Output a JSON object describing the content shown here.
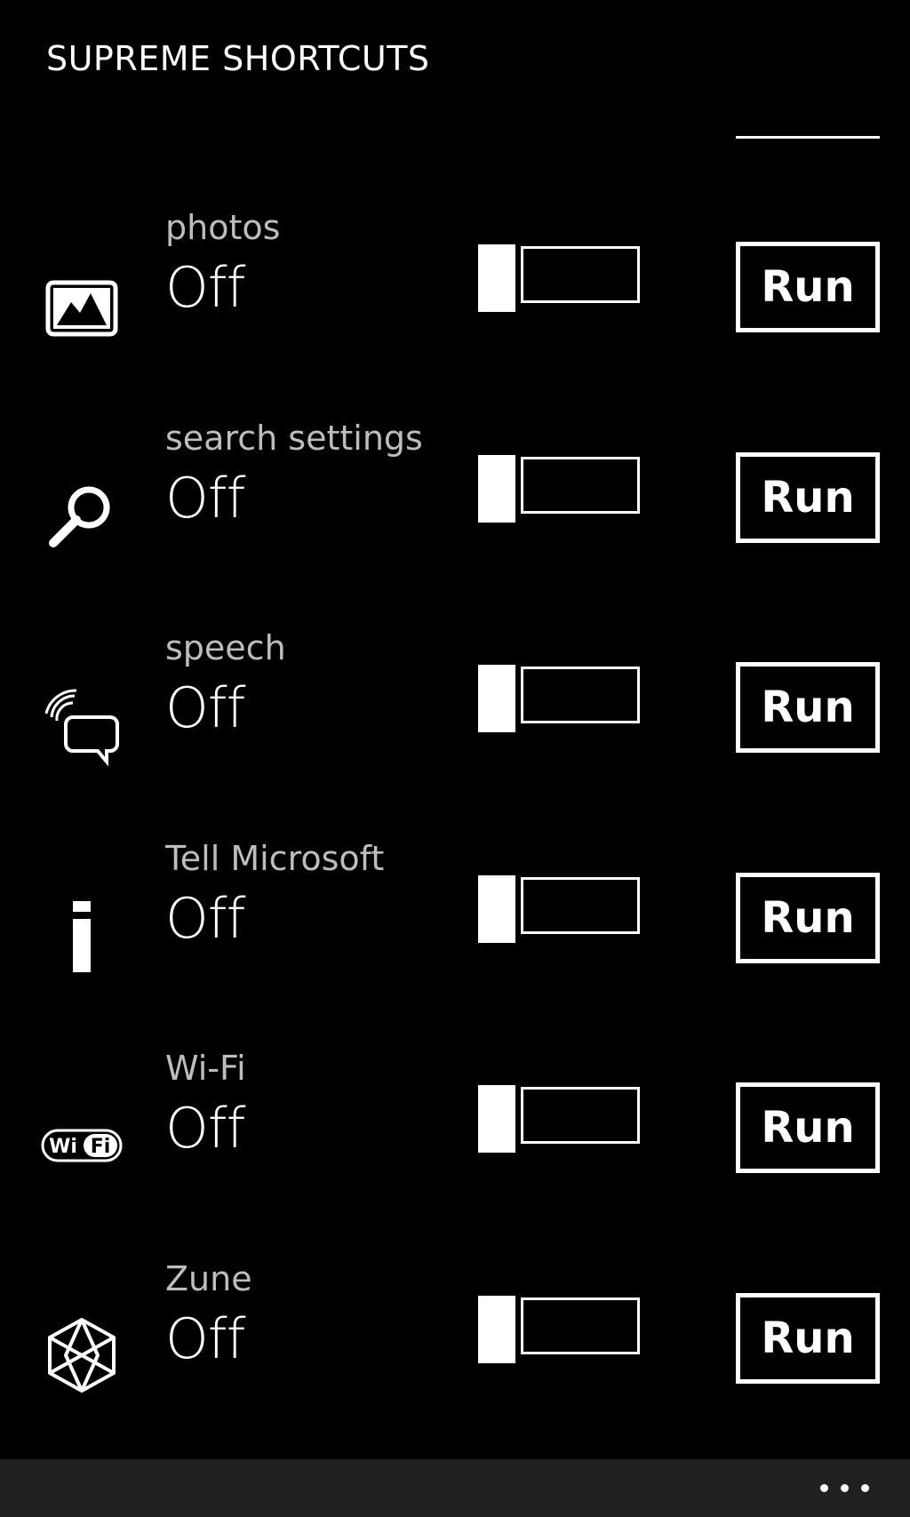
{
  "app": {
    "title": "SUPREME SHORTCUTS"
  },
  "shortcuts": [
    {
      "label": "photos",
      "status": "Off",
      "run_label": "Run",
      "icon": "photos-icon"
    },
    {
      "label": "search settings",
      "status": "Off",
      "run_label": "Run",
      "icon": "search-icon"
    },
    {
      "label": "speech",
      "status": "Off",
      "run_label": "Run",
      "icon": "speech-icon"
    },
    {
      "label": "Tell Microsoft",
      "status": "Off",
      "run_label": "Run",
      "icon": "info-icon"
    },
    {
      "label": "Wi-Fi",
      "status": "Off",
      "run_label": "Run",
      "icon": "wifi-icon"
    },
    {
      "label": "Zune",
      "status": "Off",
      "run_label": "Run",
      "icon": "zune-icon"
    }
  ],
  "app_bar": {
    "more_icon": "more-icon"
  },
  "colors": {
    "background": "#000000",
    "foreground": "#ffffff",
    "label": "#bdbdbd",
    "app_bar": "#1f201f"
  }
}
